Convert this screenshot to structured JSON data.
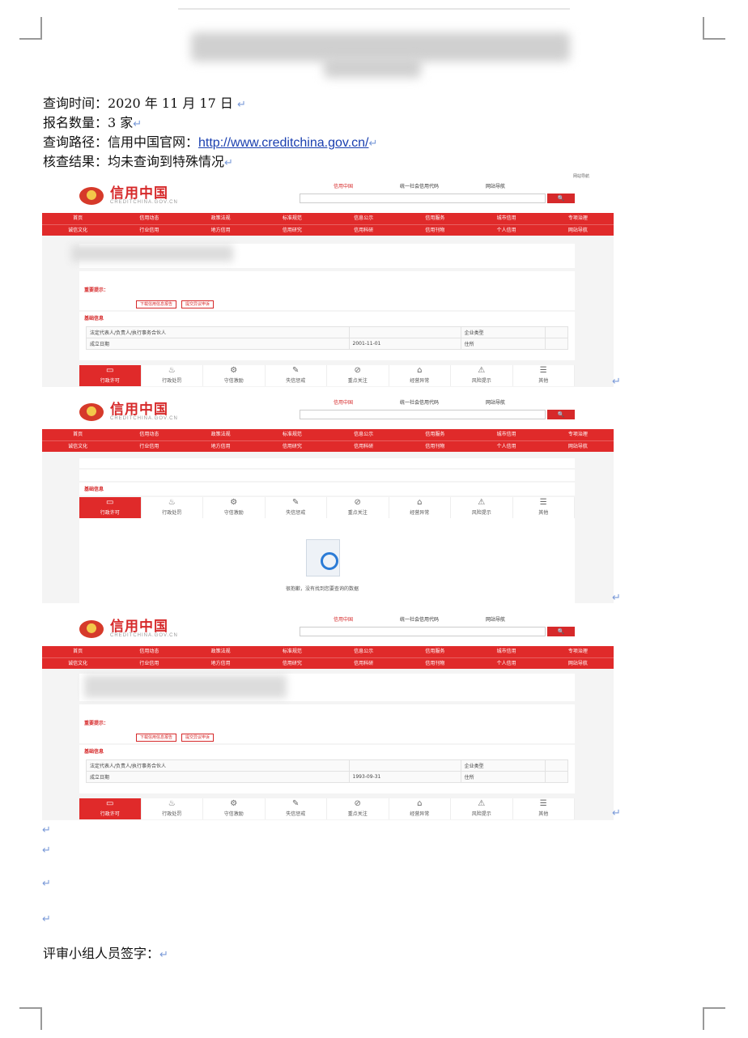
{
  "doc": {
    "query_time": "查询时间：2020 年 11 月 17 日 ",
    "count": "报名数量：3 家",
    "path_label": "查询路径：信用中国官网：",
    "path_url": "http://www.creditchina.gov.cn/",
    "result": "核查结果：均未查询到特殊情况",
    "signature": "评审小组人员签字：",
    "para_mark": "↵"
  },
  "site": {
    "logo_cn": "信用中国",
    "logo_en": "CREDITCHINA.GOV.CN",
    "top_links": [
      "信用中国",
      "统一社会信用代码",
      "网站导航"
    ],
    "search_btn": "🔍",
    "nav_row1": [
      "首页",
      "信用动态",
      "政策法规",
      "标准规范",
      "信息公示",
      "信用服务",
      "城市信用",
      "专项治理"
    ],
    "nav_row2": [
      "诚信文化",
      "行业信用",
      "地方信用",
      "信用研究",
      "信用科研",
      "信用刊物",
      "个人信用",
      "网站导航"
    ],
    "notice_label": "重要提示：",
    "notice_btn1": "下载信用信息报告",
    "notice_btn2": "提交异议申诉",
    "basic_info": "基础信息",
    "tab_labels": [
      "行政许可",
      "行政处罚",
      "守信激励",
      "失信惩戒",
      "重点关注",
      "经营异常",
      "风险提示",
      "其他"
    ],
    "tab_icons": [
      "▭",
      "♨",
      "⚙",
      "✎",
      "⊘",
      "⌂",
      "⚠",
      "☰"
    ],
    "empty_text": "很抱歉，没有找到您要查询的数据"
  },
  "shots": [
    {
      "legal_rep": "法定代表人/负责人/执行事务合伙人",
      "est_date": "成立日期",
      "date_val": "2001-11-01",
      "type_label": "企业类型",
      "addr_label": "住所"
    },
    {},
    {
      "legal_rep": "法定代表人/负责人/执行事务合伙人",
      "est_date": "成立日期",
      "date_val": "1993-09-31",
      "type_label": "企业类型",
      "addr_label": "住所"
    }
  ]
}
